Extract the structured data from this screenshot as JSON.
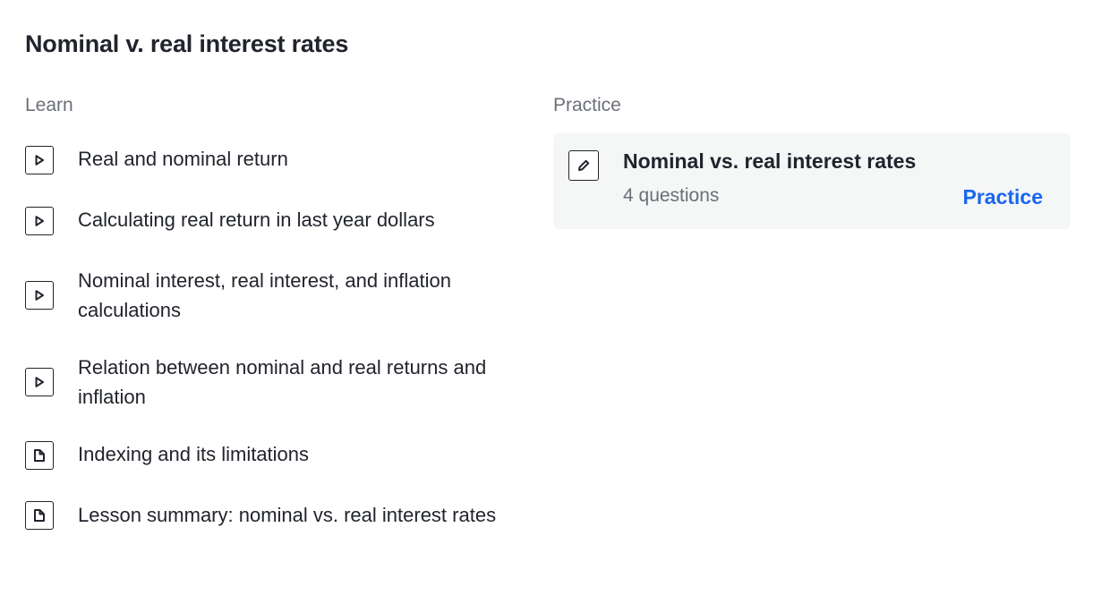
{
  "unit": {
    "title": "Nominal v. real interest rates"
  },
  "learn": {
    "label": "Learn",
    "items": [
      {
        "label": "Real and nominal return",
        "icon": "play-icon"
      },
      {
        "label": "Calculating real return in last year dollars",
        "icon": "play-icon"
      },
      {
        "label": "Nominal interest, real interest, and inflation calculations",
        "icon": "play-icon"
      },
      {
        "label": "Relation between nominal and real returns and inflation",
        "icon": "play-icon"
      },
      {
        "label": "Indexing and its limitations",
        "icon": "article-icon"
      },
      {
        "label": "Lesson summary: nominal vs. real interest rates",
        "icon": "article-icon"
      }
    ]
  },
  "practice": {
    "label": "Practice",
    "card": {
      "title": "Nominal vs. real interest rates",
      "subtitle": "4 questions",
      "action_label": "Practice",
      "icon": "pencil-icon"
    }
  },
  "colors": {
    "text": "#21242c",
    "muted": "#6b6f78",
    "link": "#1865f2",
    "card_bg": "#f5f6f6"
  }
}
